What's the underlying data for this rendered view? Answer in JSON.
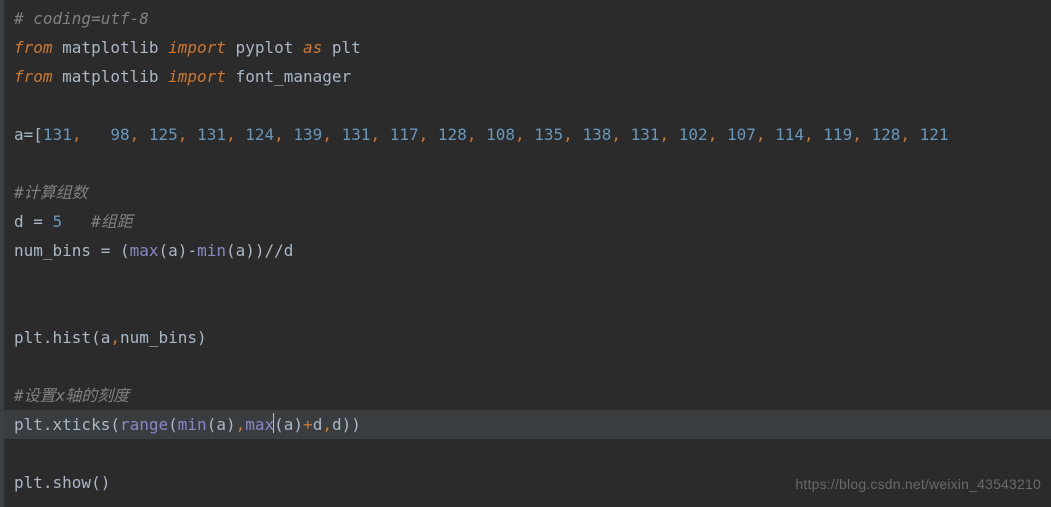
{
  "code": {
    "l1_comment": "# coding=utf-8",
    "l2_from": "from",
    "l2_mod": " matplotlib ",
    "l2_import": "import",
    "l2_rest1": " pyplot ",
    "l2_as": "as",
    "l2_rest2": " plt",
    "l3_from": "from",
    "l3_mod": " matplotlib ",
    "l3_import": "import",
    "l3_rest": " font_manager",
    "l5_a": "a",
    "l5_eq": "=",
    "l5_lb": "[",
    "l5_nums": [
      "131",
      "98",
      "125",
      "131",
      "124",
      "139",
      "131",
      "117",
      "128",
      "108",
      "135",
      "138",
      "131",
      "102",
      "107",
      "114",
      "119",
      "128",
      "121"
    ],
    "l5_sep_first": ",   ",
    "l5_sep": ", ",
    "l7_comment": "#计算组数",
    "l8_d": "d ",
    "l8_eq": "=",
    "l8_five": " 5",
    "l8_cmt": "   #组距",
    "l9_lhs": "num_bins ",
    "l9_eq": "=",
    "l9_sp": " ",
    "l9_p1": "(",
    "l9_max": "max",
    "l9_pa": "(a)",
    "l9_minus": "-",
    "l9_min": "min",
    "l9_pb": "(a)",
    "l9_p2": ")",
    "l9_fd": "//",
    "l9_d": "d",
    "l12_plt": "plt.hist(a",
    "l12_c": ",",
    "l12_rest": "num_bins)",
    "l14_cmt": "#设置x轴的刻度",
    "l15_a": "plt.xticks(",
    "l15_range": "range",
    "l15_b": "(",
    "l15_min": "min",
    "l15_c": "(a)",
    "l15_cm1": ",",
    "l15_max": "max",
    "l15_d": "(a)",
    "l15_plus": "+",
    "l15_e": "d",
    "l15_cm2": ",",
    "l15_f": "d))",
    "l17": "plt.show()"
  },
  "watermark": "https://blog.csdn.net/weixin_43543210"
}
